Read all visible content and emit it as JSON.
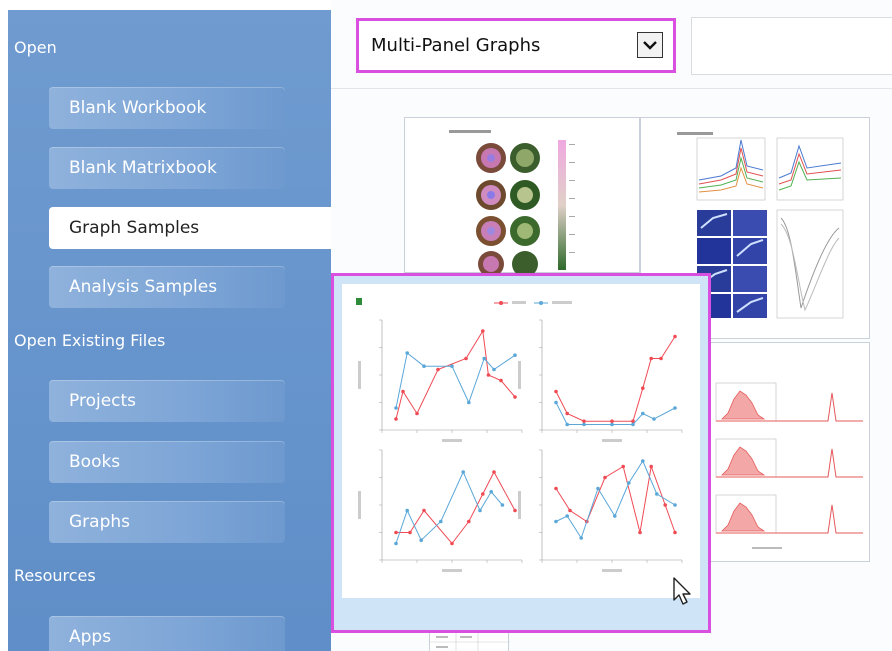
{
  "sidebar": {
    "sections": {
      "open": {
        "title": "Open",
        "items": [
          {
            "label": "Blank Workbook"
          },
          {
            "label": "Blank Matrixbook"
          },
          {
            "label": "Graph Samples",
            "active": true
          },
          {
            "label": "Analysis Samples"
          }
        ]
      },
      "open_existing": {
        "title": "Open Existing Files",
        "items": [
          {
            "label": "Projects"
          },
          {
            "label": "Books"
          },
          {
            "label": "Graphs"
          }
        ]
      },
      "resources": {
        "title": "Resources",
        "items": [
          {
            "label": "Apps"
          }
        ]
      }
    }
  },
  "category": {
    "selected": "Multi-Panel Graphs"
  },
  "colors": {
    "sidebar": "#6f9bd0",
    "highlight": "#d94fe0",
    "series_red": "#ef4b55",
    "series_blue": "#5aa7d8"
  }
}
